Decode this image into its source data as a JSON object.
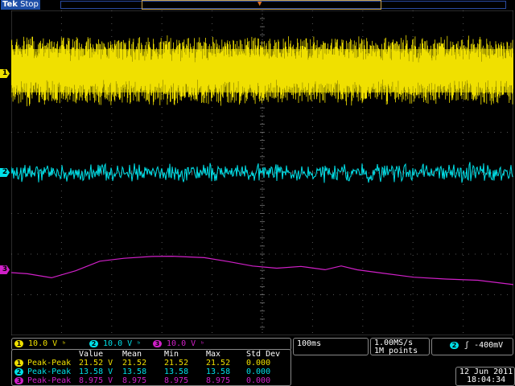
{
  "topbar": {
    "brand": "Tek",
    "state": "Stop",
    "trigger_pos_glyph": "▼"
  },
  "colors": {
    "ch1": "#f0e000",
    "ch2": "#00e0e8",
    "ch3": "#d020c8",
    "grid": "#6a6a6a",
    "trigger": "#e07020"
  },
  "channels": [
    {
      "id": "1",
      "scale": "10.0 V",
      "coupling_icon": "bandwidth-limit-icon"
    },
    {
      "id": "2",
      "scale": "10.0 V",
      "coupling_icon": "bandwidth-limit-icon"
    },
    {
      "id": "3",
      "scale": "10.0 V",
      "coupling_icon": "bandwidth-limit-icon"
    }
  ],
  "horizontal": {
    "timebase": "100ms",
    "sample_rate": "1.00MS/s",
    "record_length": "1M points"
  },
  "trigger": {
    "source": "2",
    "slope_icon": "rising-edge-icon",
    "level": "-400mV"
  },
  "measurements": {
    "headers": [
      "Value",
      "Mean",
      "Min",
      "Max",
      "Std Dev"
    ],
    "rows": [
      {
        "channel": "1",
        "name": "Peak-Peak",
        "value": "21.52 V",
        "mean": "21.52",
        "min": "21.52",
        "max": "21.52",
        "std": "0.000"
      },
      {
        "channel": "2",
        "name": "Peak-Peak",
        "value": "13.58 V",
        "mean": "13.58",
        "min": "13.58",
        "max": "13.58",
        "std": "0.000"
      },
      {
        "channel": "3",
        "name": "Peak-Peak",
        "value": "8.975 V",
        "mean": "8.975",
        "min": "8.975",
        "max": "8.975",
        "std": "0.000"
      }
    ]
  },
  "datetime": {
    "date": "12 Jun  2011",
    "time": "18:04:34"
  }
}
